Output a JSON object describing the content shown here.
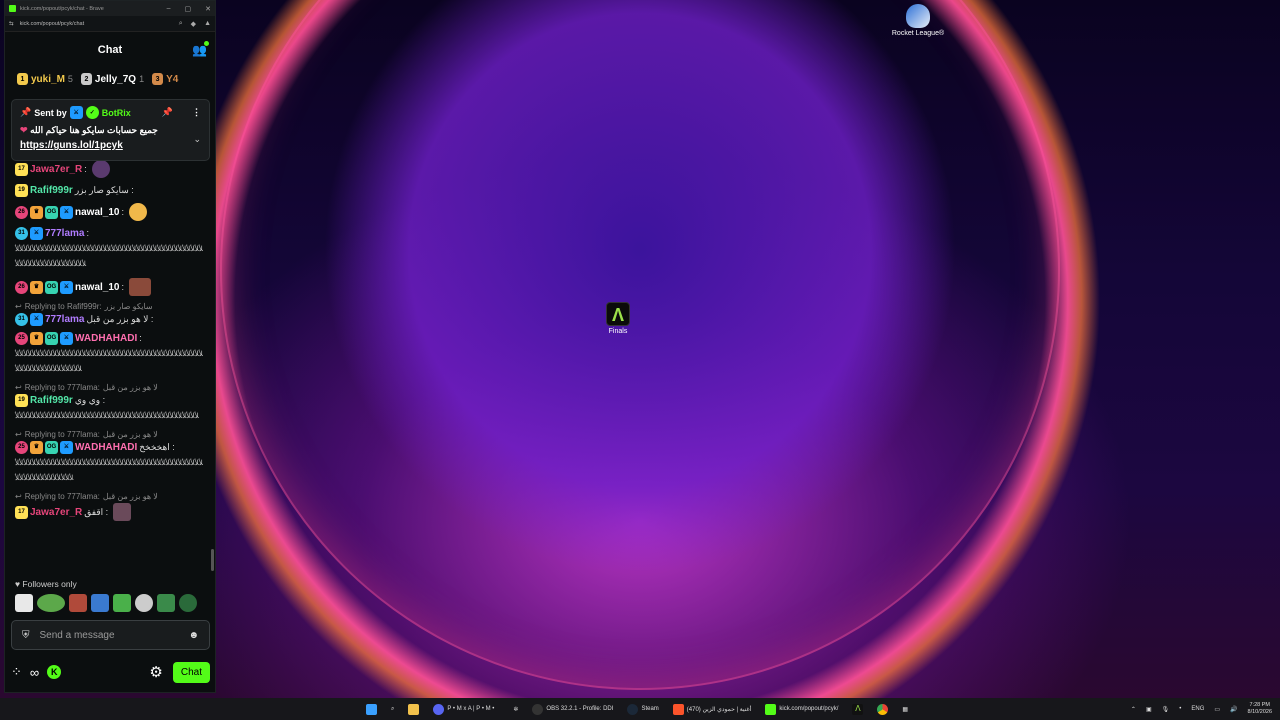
{
  "browser": {
    "title": "kick.com/popout/pcyk/chat - Brave",
    "url": "kick.com/popout/pcyk/chat",
    "minimize": "–",
    "restore": "▢",
    "close": "✕"
  },
  "chat": {
    "title": "Chat",
    "leaderboard": [
      {
        "rank": "1",
        "name": "yuki_M",
        "count": "5",
        "color": "#f2c94c"
      },
      {
        "rank": "2",
        "name": "Jelly_7Q",
        "count": "1",
        "color": "#c9c9c9"
      },
      {
        "rank": "3",
        "name": "Y4",
        "count": "",
        "color": "#d38a4a"
      }
    ],
    "pinned": {
      "sent_by": "Sent by",
      "bot_name": "BotRix",
      "message": "جميع حسابات سايكو هنا حياكم الله",
      "heart": "❤",
      "link": "https://guns.lol/1pcyk"
    },
    "messages": [
      {
        "sub": "17",
        "user": "Jawa7er_R",
        "color": "#e6457a",
        "text": ":"
      },
      {
        "sub": "19",
        "user": "Rafif999r",
        "color": "#53e6a8",
        "text": ": سايكو صار بزر"
      },
      {
        "sub": "26",
        "user": "nawal_10",
        "color": "#ffffff",
        "text": ":"
      },
      {
        "sub": "31",
        "user": "777lama",
        "color": "#b07cff",
        "text": ":",
        "spam": "ﻸﻸﻸﻸﻸﻸﻸﻸﻸﻸﻸﻸﻸﻸﻸﻸﻸﻸﻸﻸﻸﻸﻸﻸﻸﻸﻸﻸﻸﻸﻸﻸﻸﻸﻸﻸﻸﻸﻸﻸﻸﻸﻸﻸﻸﻸﻸﻸﻸﻸﻸﻸﻸﻸﻸﻸﻸﻸﻸﻸﻸﻸ"
      },
      {
        "sub": "26",
        "user": "nawal_10",
        "color": "#ffffff",
        "text": ":"
      },
      {
        "reply_to": "Replying to Rafif999r:",
        "reply_text": "سايكو صار بزر",
        "sub": "31",
        "user": "777lama",
        "color": "#b07cff",
        "text": ": لا هو بزر من قبل"
      },
      {
        "sub": "25",
        "user": "WADHAHADI",
        "color": "#ff6fb0",
        "text": ":",
        "spam": "ﻸﻸﻸﻸﻸﻸﻸﻸﻸﻸﻸﻸﻸﻸﻸﻸﻸﻸﻸﻸﻸﻸﻸﻸﻸﻸﻸﻸﻸﻸﻸﻸﻸﻸﻸﻸﻸﻸﻸﻸﻸﻸﻸﻸﻸﻸﻸﻸﻸﻸﻸﻸﻸﻸﻸﻸﻸﻸﻸﻸﻸ"
      },
      {
        "reply_to": "Replying to 777lama:",
        "reply_text": "لا هو بزر من قبل",
        "sub": "19",
        "user": "Rafif999r",
        "color": "#53e6a8",
        "text": ": وي وي",
        "spam": "ﻸﻸﻸﻸﻸﻸﻸﻸﻸﻸﻸﻸﻸﻸﻸﻸﻸﻸﻸﻸﻸﻸﻸﻸﻸﻸﻸﻸﻸﻸﻸﻸﻸﻸﻸﻸﻸﻸﻸﻸﻸﻸﻸﻸ"
      },
      {
        "reply_to": "Replying to 777lama:",
        "reply_text": "لا هو بزر من قبل",
        "sub": "25",
        "user": "WADHAHADI",
        "color": "#ff6fb0",
        "text": ": اهخخخخ",
        "spam": "ﻸﻸﻸﻸﻸﻸﻸﻸﻸﻸﻸﻸﻸﻸﻸﻸﻸﻸﻸﻸﻸﻸﻸﻸﻸﻸﻸﻸﻸﻸﻸﻸﻸﻸﻸﻸﻸﻸﻸﻸﻸﻸﻸﻸﻸﻸﻸﻸﻸﻸﻸﻸﻸﻸﻸﻸﻸﻸﻸ"
      },
      {
        "reply_to": "Replying to 777lama:",
        "reply_text": "لا هو بزر من قبل",
        "sub": "17",
        "user": "Jawa7er_R",
        "color": "#e6457a",
        "text": ": اقفق"
      }
    ],
    "followers_only": "Followers only",
    "input_placeholder": "Send a message",
    "chat_button": "Chat"
  },
  "desktop": {
    "icons": [
      {
        "label": "Rocket League®"
      },
      {
        "label": "Finals"
      }
    ]
  },
  "taskbar": {
    "items": [
      {
        "label": "P • M x A | P • M •"
      },
      {
        "label": "OBS 32.2.1 - Profile: DDI"
      },
      {
        "label": "Steam"
      },
      {
        "label": "أغنية | حمودي الزين (470)"
      },
      {
        "label": "kick.com/popout/pcyk/"
      }
    ],
    "time": "7:28 PM",
    "date": "8/10/2026",
    "lang": "ENG"
  }
}
